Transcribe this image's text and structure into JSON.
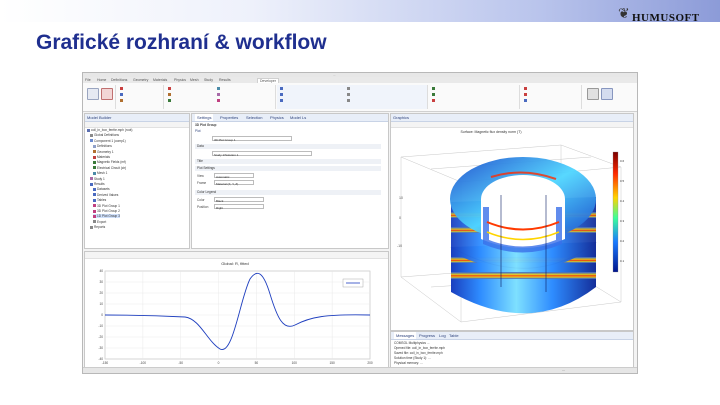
{
  "slide": {
    "title": "Grafické rozhraní & workflow",
    "logo_text": "HUMUSOFT",
    "logo_mark": "❦"
  },
  "colors": {
    "title": "#1f2f8f",
    "banner_end": "#8c9bd8",
    "accent_red": "#c94040",
    "panel_header": "#e8eef8",
    "selection": "#cfe0fb"
  },
  "app": {
    "window_title": "...",
    "menu_tabs": [
      "File",
      "Home",
      "Definitions",
      "Geometry",
      "Materials",
      "Physics",
      "Mesh",
      "Study",
      "Results",
      "Developer"
    ],
    "model_builder": {
      "title": "Model Builder",
      "tree": [
        {
          "label": "coil_in_box_ferrite.mph (root)",
          "icon": "model-icon",
          "color": "#5b6fb0"
        },
        {
          "label": "Global Definitions",
          "icon": "globe-icon",
          "color": "#8a8a8a"
        },
        {
          "label": "Component 1 (comp1)",
          "icon": "component-icon",
          "color": "#6a8ad0"
        },
        {
          "label": "Definitions",
          "icon": "definitions-icon",
          "color": "#8fa0c8"
        },
        {
          "label": "Geometry 1",
          "icon": "geometry-icon",
          "color": "#b07030"
        },
        {
          "label": "Materials",
          "icon": "materials-icon",
          "color": "#c04040"
        },
        {
          "label": "Magnetic Fields (mf)",
          "icon": "physics-icon",
          "color": "#3a7a3a"
        },
        {
          "label": "Electrical Circuit (cir)",
          "icon": "circuit-icon",
          "color": "#3a7a3a"
        },
        {
          "label": "Mesh 1",
          "icon": "mesh-icon",
          "color": "#4b8ba8"
        },
        {
          "label": "Study 1",
          "icon": "study-icon",
          "color": "#a86aa8"
        },
        {
          "label": "Results",
          "icon": "results-icon",
          "color": "#4a6ac0"
        },
        {
          "label": "Datasets",
          "icon": "datasets-icon",
          "color": "#4a6ac0"
        },
        {
          "label": "Derived Values",
          "icon": "derived-icon",
          "color": "#4a6ac0"
        },
        {
          "label": "Tables",
          "icon": "tables-icon",
          "color": "#4a6ac0"
        },
        {
          "label": "3D Plot Group 1",
          "icon": "plot3d-icon",
          "color": "#c04080"
        },
        {
          "label": "3D Plot Group 2",
          "icon": "plot3d-icon",
          "color": "#c04080"
        },
        {
          "label": "1D Plot Group 3",
          "icon": "plot1d-icon",
          "color": "#c04080"
        },
        {
          "label": "Export",
          "icon": "export-icon",
          "color": "#888888"
        },
        {
          "label": "Reports",
          "icon": "reports-icon",
          "color": "#888888"
        }
      ]
    },
    "settings": {
      "tabs": [
        "Settings",
        "Properties",
        "Selection",
        "Physics",
        "Model Ls"
      ],
      "header": "3D Plot Group",
      "plot_label": "Plot",
      "label_field": "3D Plot Group 1",
      "data_section": "Data",
      "dataset_value": "Study 1/Solution 1",
      "title_section": "Title",
      "plot_settings_section": "Plot Settings",
      "view_label": "View",
      "view_value": "Automatic",
      "frame_label": "Frame",
      "frame_value": "Material (X, Y, Z)",
      "color_legend_section": "Color Legend",
      "color_label": "Color",
      "color_value": "Black",
      "position_label": "Position",
      "position_value": "Right"
    },
    "plot_1d": {
      "title": "Global: R, fitted",
      "y_ticks": [
        "40",
        "30",
        "20",
        "10",
        "0",
        "-10",
        "-20",
        "-30",
        "-40"
      ],
      "x_ticks": [
        "-150",
        "-100",
        "-50",
        "0",
        "50",
        "100",
        "150",
        "200"
      ]
    },
    "graphics": {
      "tab": "Graphics",
      "plot_title": "Surface: Magnetic flux density norm (T)",
      "axis_ticks": [
        "-10",
        "0",
        "10"
      ],
      "colorbar_ticks": [
        "0.6",
        "0.5",
        "0.4",
        "0.3",
        "0.2",
        "0.1"
      ]
    },
    "messages": {
      "tabs": [
        "Messages",
        "Progress",
        "Log",
        "Table"
      ],
      "lines": [
        "COMSOL Multiphysics ...",
        "Opened file: coil_in_box_ferrite.mph",
        "Saved file: coil_in_box_ferrite.mph",
        "Solution time (Study 1): ...",
        "Physical memory: ..."
      ]
    },
    "status_text": "..."
  }
}
